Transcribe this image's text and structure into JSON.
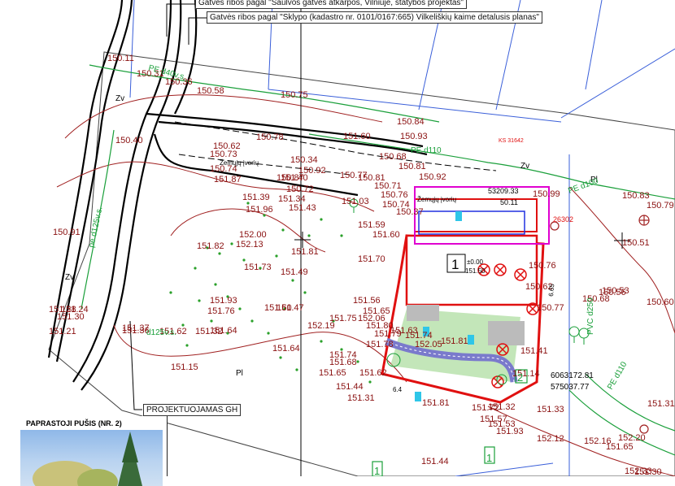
{
  "callouts": {
    "top_1": "Gatvės ribos pagal \"Saulvos gatvės atkarpos, Vilniuje, statybos projektas\"",
    "top_2": "Gatvės ribos pagal \"Sklypo (kadastro nr. 0101/0167:665) Vilkeliškių kaime detalusis planas\"",
    "gh": "PROJEKTUOJAMAS GH"
  },
  "sidebar": {
    "header": "PAPRASTOJI PUŠIS (NR. 2)"
  },
  "building": {
    "number": "1",
    "level": "±0.00",
    "elevation": "151.50"
  },
  "labels": {
    "zv_1": "Zv",
    "zv_2": "Zv",
    "zv_3": "Zv",
    "pl_1": "Pl",
    "pl_2": "Pl",
    "zemu_1": "Žemųjų įvorių",
    "zemu_2": "Žemųjų įvorių",
    "ks": "KS 31642",
    "coord_x": "6063172.81",
    "coord_y": "575037.77",
    "pvc": "PVC d250",
    "pe_d110_a": "PE d110",
    "pe_d110_b": "PE d110",
    "pe_d125_a": "pe d125v.s.",
    "pe_d125_b": "d125v.s.",
    "pe_d100": "PE d100",
    "pe_d40": "PE d40v.s.",
    "dim_64": "6.4",
    "dim_665": "6.65",
    "num_2": "2",
    "num_1a": "1",
    "num_1b": "1",
    "ref_26302": "26302",
    "ref_1": "53209.33",
    "ref_2": "50.11"
  },
  "elevations": [
    "150.11",
    "150.31",
    "150.36",
    "150.58",
    "150.75",
    "150.84",
    "150.93",
    "150.40",
    "150.78",
    "150.62",
    "151.60",
    "150.68",
    "150.81",
    "150.92",
    "150.73",
    "150.74",
    "151.87",
    "150.34",
    "150.92",
    "150.77",
    "150.81",
    "150.87",
    "151.40",
    "150.72",
    "150.76",
    "150.71",
    "150.99",
    "150.83",
    "150.79",
    "151.39",
    "151.34",
    "151.03",
    "150.74",
    "150.37",
    "151.96",
    "151.43",
    "151.59",
    "151.60",
    "150.91",
    "152.00",
    "151.82",
    "152.13",
    "151.81",
    "151.70",
    "150.51",
    "151.73",
    "151.49",
    "151.56",
    "151.65",
    "150.76",
    "150.53",
    "151.93",
    "151.60",
    "151.76",
    "150.62",
    "150.56",
    "150.68",
    "151.24",
    "151.75",
    "151.47",
    "151.80",
    "151.79",
    "151.74",
    "150.77",
    "150.60",
    "151.28",
    "152.05",
    "152.19",
    "152.06",
    "151.63",
    "151.64",
    "151.78",
    "151.81",
    "151.21",
    "151.30",
    "151.36",
    "151.37",
    "151.62",
    "151.32",
    "151.64",
    "151.74",
    "151.68",
    "151.41",
    "151.15",
    "151.65",
    "151.62",
    "151.44",
    "151.14",
    "151.31",
    "151.81",
    "151.72",
    "151.32",
    "151.33",
    "151.57",
    "151.53",
    "151.93",
    "152.12",
    "152.16",
    "152.20",
    "151.65",
    "152.33",
    "151.44",
    "151.31",
    "151.30"
  ]
}
